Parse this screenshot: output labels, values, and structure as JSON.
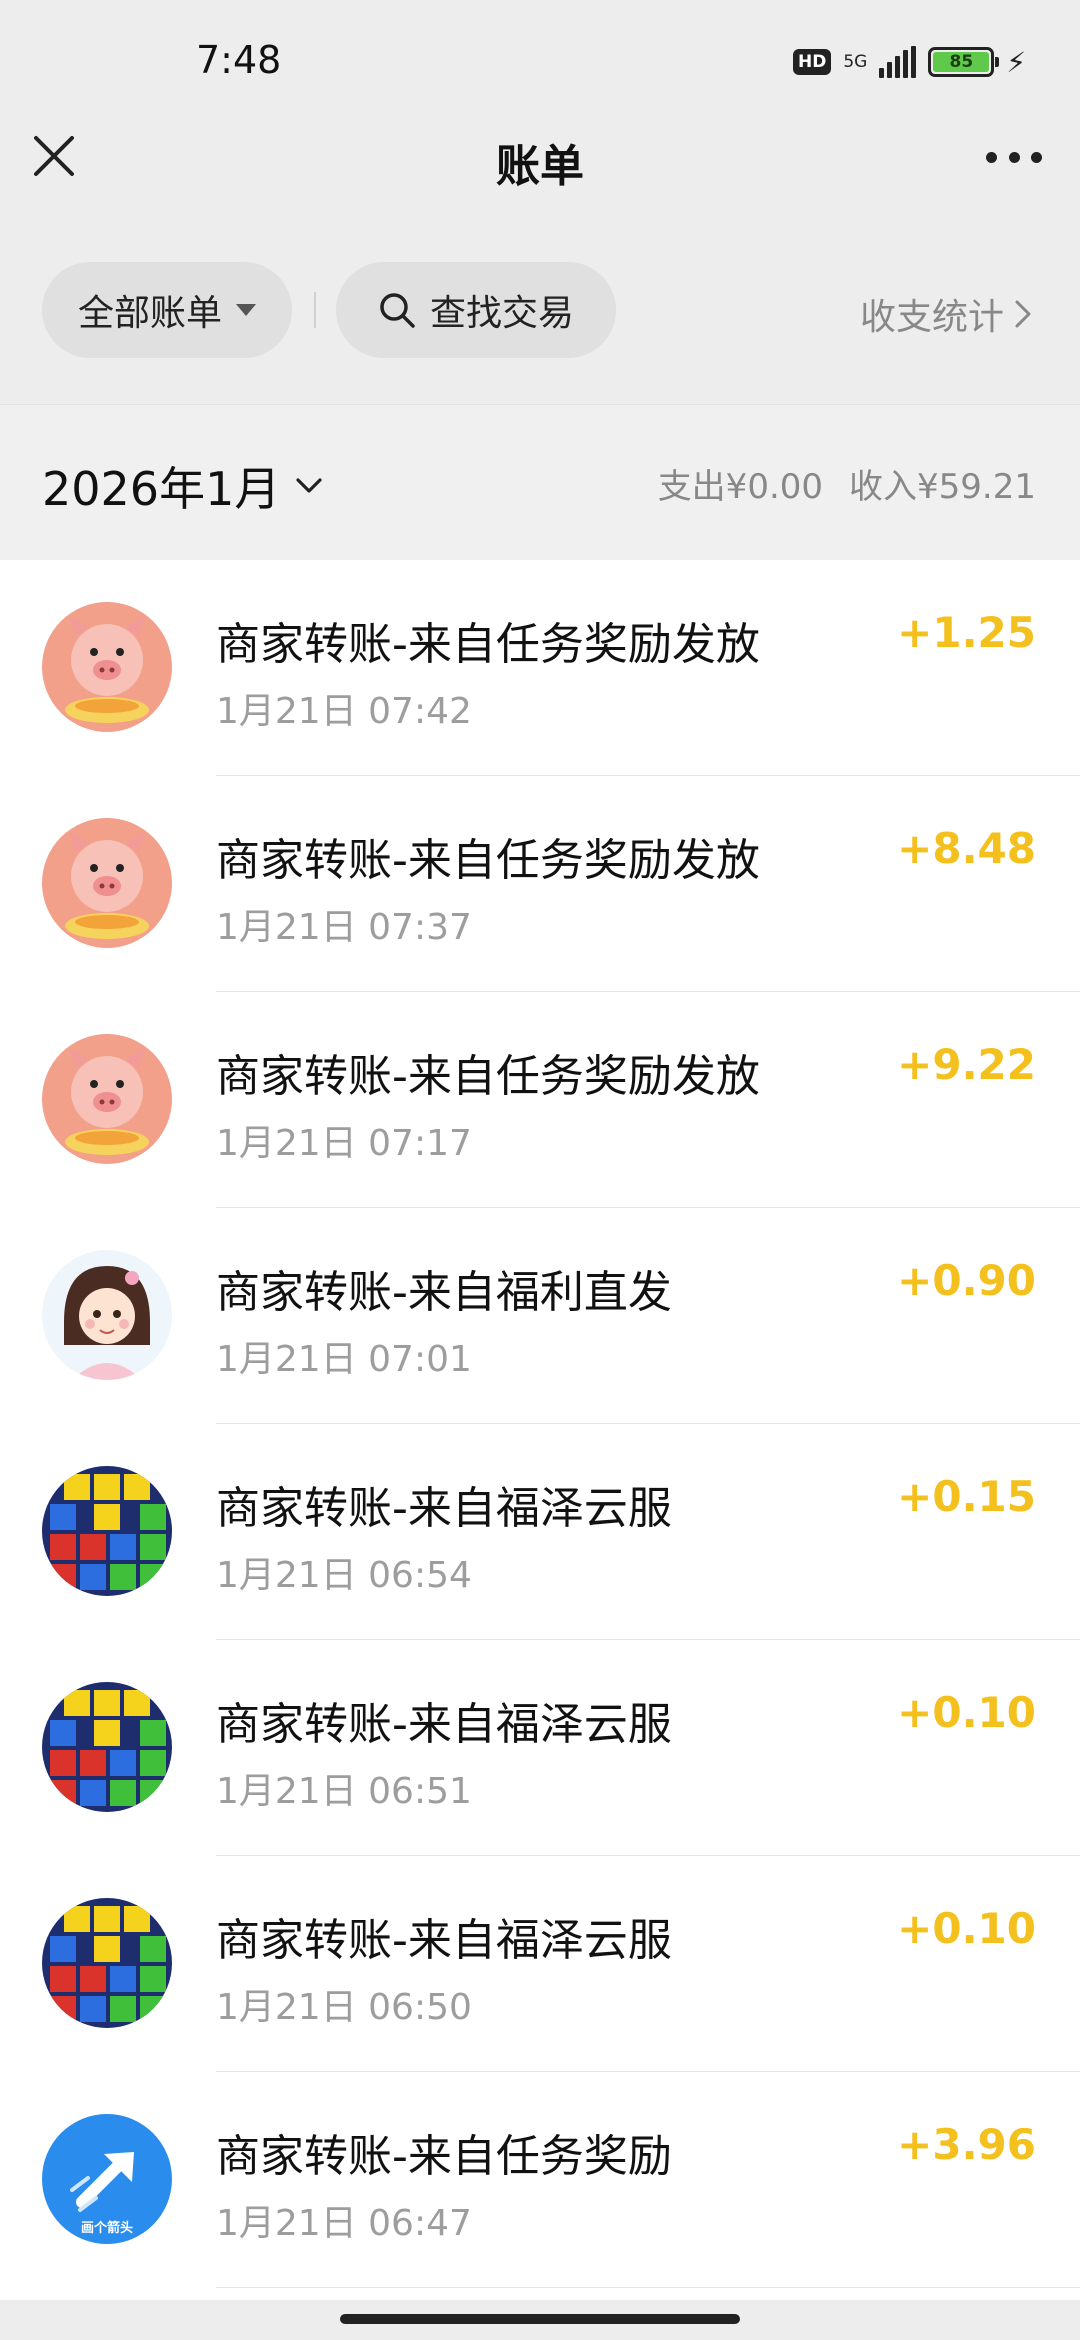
{
  "status_bar": {
    "time": "7:48",
    "hd": "HD",
    "network": "5G",
    "battery": "85"
  },
  "nav": {
    "title": "账单"
  },
  "filters": {
    "all_bills": "全部账单",
    "search": "查找交易",
    "stats": "收支统计"
  },
  "month": {
    "label": "2026年1月",
    "expense": "支出¥0.00",
    "income": "收入¥59.21"
  },
  "transactions": [
    {
      "title": "商家转账-来自任务奖励发放",
      "time": "1月21日 07:42",
      "amount": "+1.25",
      "avatar": "pig"
    },
    {
      "title": "商家转账-来自任务奖励发放",
      "time": "1月21日 07:37",
      "amount": "+8.48",
      "avatar": "pig"
    },
    {
      "title": "商家转账-来自任务奖励发放",
      "time": "1月21日 07:17",
      "amount": "+9.22",
      "avatar": "pig"
    },
    {
      "title": "商家转账-来自福利直发",
      "time": "1月21日 07:01",
      "amount": "+0.90",
      "avatar": "girl"
    },
    {
      "title": "商家转账-来自福泽云服",
      "time": "1月21日 06:54",
      "amount": "+0.15",
      "avatar": "blocks"
    },
    {
      "title": "商家转账-来自福泽云服",
      "time": "1月21日 06:51",
      "amount": "+0.10",
      "avatar": "blocks"
    },
    {
      "title": "商家转账-来自福泽云服",
      "time": "1月21日 06:50",
      "amount": "+0.10",
      "avatar": "blocks"
    },
    {
      "title": "商家转账-来自任务奖励",
      "time": "1月21日 06:47",
      "amount": "+3.96",
      "avatar": "arrow",
      "avatar_text": "画个箭头"
    }
  ],
  "colors": {
    "income": "#f3c01e",
    "background": "#ededed"
  }
}
